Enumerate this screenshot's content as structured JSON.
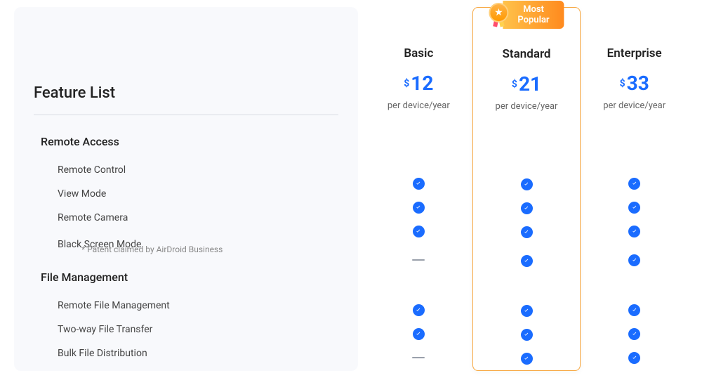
{
  "title": "Feature List",
  "badge": "Most Popular",
  "plans": [
    {
      "name": "Basic",
      "currency": "$",
      "price": "12",
      "unit": "per device/year"
    },
    {
      "name": "Standard",
      "currency": "$",
      "price": "21",
      "unit": "per device/year"
    },
    {
      "name": "Enterprise",
      "currency": "$",
      "price": "33",
      "unit": "per device/year"
    }
  ],
  "sections": [
    {
      "title": "Remote Access",
      "features": [
        {
          "label": "Remote Control",
          "sub": "",
          "vals": [
            "y",
            "y",
            "y"
          ]
        },
        {
          "label": "View Mode",
          "sub": "",
          "vals": [
            "y",
            "y",
            "y"
          ]
        },
        {
          "label": "Remote Camera",
          "sub": "",
          "vals": [
            "y",
            "y",
            "y"
          ]
        },
        {
          "label": "Black Screen Mode",
          "sub": "* Patent claimed by AirDroid Business",
          "vals": [
            "n",
            "y",
            "y"
          ]
        }
      ]
    },
    {
      "title": "File Management",
      "features": [
        {
          "label": "Remote File Management",
          "sub": "",
          "vals": [
            "y",
            "y",
            "y"
          ]
        },
        {
          "label": "Two-way File Transfer",
          "sub": "",
          "vals": [
            "y",
            "y",
            "y"
          ]
        },
        {
          "label": "Bulk File Distribution",
          "sub": "",
          "vals": [
            "n",
            "y",
            "y"
          ]
        }
      ]
    }
  ]
}
